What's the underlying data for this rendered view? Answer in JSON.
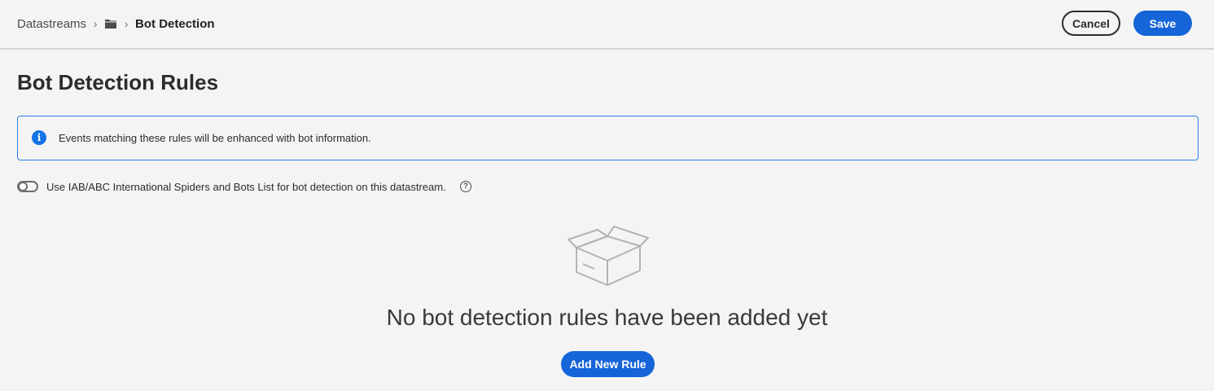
{
  "breadcrumb": {
    "root": "Datastreams",
    "folder_icon": "folder-icon",
    "current": "Bot Detection"
  },
  "toolbar": {
    "cancel_label": "Cancel",
    "save_label": "Save"
  },
  "page": {
    "title": "Bot Detection Rules"
  },
  "info": {
    "icon": "info-icon",
    "message": "Events matching these rules will be enhanced with bot information."
  },
  "iab_toggle": {
    "label": "Use IAB/ABC International Spiders and Bots List for bot detection on this datastream.",
    "enabled": false,
    "help_icon": "help-icon"
  },
  "empty_state": {
    "illustration": "empty-box-icon",
    "heading": "No bot detection rules have been added yet",
    "button_label": "Add New Rule"
  },
  "colors": {
    "accent": "#1565d8",
    "info_border": "#2680eb",
    "background": "#f4f4f4"
  }
}
